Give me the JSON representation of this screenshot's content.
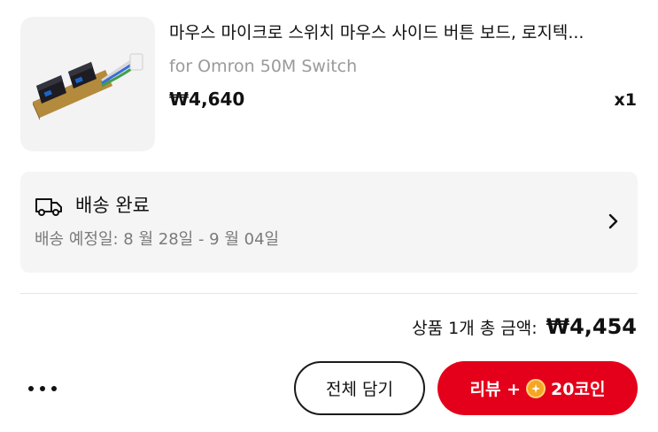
{
  "product": {
    "image_icon": "mouse-switch-board-photo",
    "title": "마우스 마이크로 스위치 마우스 사이드 버튼 보드, 로지텍...",
    "variant": "for Omron 50M Switch",
    "price": "₩4,640",
    "quantity": "x1"
  },
  "delivery": {
    "icon": "truck-icon",
    "status": "배송 완료",
    "eta": "배송 예정일: 8 월 28일 - 9 월 04일",
    "chevron_icon": "chevron-right-icon"
  },
  "summary": {
    "total_label": "상품 1개 총 금액:",
    "total_value": "₩4,454"
  },
  "actions": {
    "more_icon": "more-horizontal-icon",
    "cart_all_label": "전체 담기",
    "review_prefix": "리뷰 +",
    "coin_icon": "coin-icon",
    "review_reward": "20코인"
  },
  "colors": {
    "accent_red": "#e4001a",
    "coin": "#f6a623",
    "card_bg": "#f5f5f5",
    "muted_text": "#9a9a9a"
  }
}
